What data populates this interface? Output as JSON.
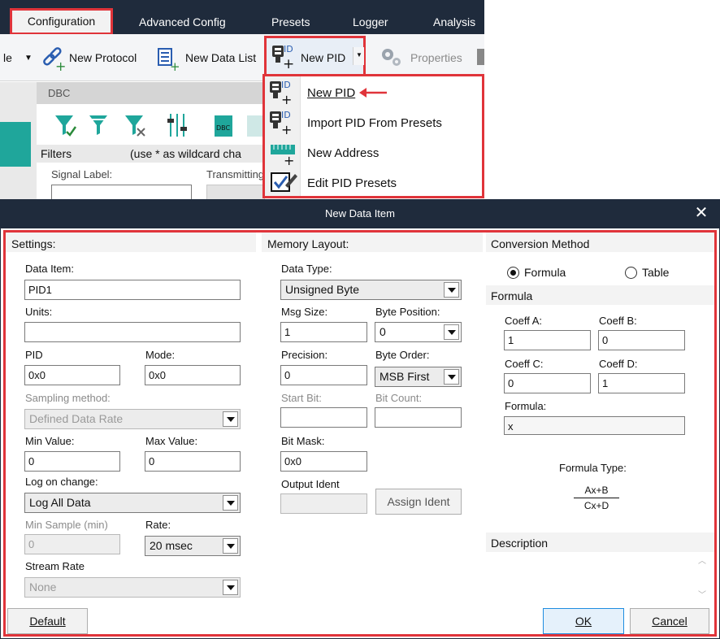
{
  "menu": {
    "configuration": "Configuration",
    "advanced": "Advanced Config",
    "presets": "Presets",
    "logger": "Logger",
    "analysis": "Analysis"
  },
  "toolbar": {
    "truncated": "le",
    "new_protocol": "New Protocol",
    "new_data_list": "New Data List",
    "new_pid": "New PID",
    "properties": "Properties"
  },
  "background": {
    "dbc": "DBC",
    "filters": "Filters",
    "filters_hint": "(use * as wildcard cha",
    "signal_label": "Signal Label:",
    "transmitting": "Transmitting"
  },
  "dropdown": {
    "items": [
      {
        "label": "New PID",
        "icon": "pid-add-icon"
      },
      {
        "label": "Import PID From Presets",
        "icon": "pid-import-icon"
      },
      {
        "label": "New Address",
        "icon": "address-add-icon"
      },
      {
        "label": "Edit PID Presets",
        "icon": "edit-check-icon"
      }
    ]
  },
  "dialog": {
    "title": "New Data Item",
    "settings": {
      "title": "Settings:",
      "data_item_label": "Data Item:",
      "data_item_value": "PID1",
      "units_label": "Units:",
      "units_value": "",
      "pid_label": "PID",
      "pid_value": "0x0",
      "mode_label": "Mode:",
      "mode_value": "0x0",
      "sampling_label": "Sampling method:",
      "sampling_value": "Defined Data Rate",
      "min_label": "Min Value:",
      "min_value": "0",
      "max_label": "Max Value:",
      "max_value": "0",
      "log_label": "Log on change:",
      "log_value": "Log All Data",
      "min_sample_label": "Min Sample (min)",
      "min_sample_value": "0",
      "rate_label": "Rate:",
      "rate_value": "20 msec",
      "stream_label": "Stream Rate",
      "stream_value": "None"
    },
    "memory": {
      "title": "Memory Layout:",
      "data_type_label": "Data Type:",
      "data_type_value": "Unsigned Byte",
      "msg_size_label": "Msg Size:",
      "msg_size_value": "1",
      "byte_pos_label": "Byte Position:",
      "byte_pos_value": "0",
      "precision_label": "Precision:",
      "precision_value": "0",
      "byte_order_label": "Byte Order:",
      "byte_order_value": "MSB First",
      "start_bit_label": "Start Bit:",
      "bit_count_label": "Bit Count:",
      "bit_mask_label": "Bit Mask:",
      "bit_mask_value": "0x0",
      "output_ident_label": "Output Ident",
      "assign_ident": "Assign Ident"
    },
    "conversion": {
      "title": "Conversion Method",
      "radio_formula": "Formula",
      "radio_table": "Table",
      "formula_title": "Formula",
      "coeff_a_label": "Coeff A:",
      "coeff_a_value": "1",
      "coeff_b_label": "Coeff B:",
      "coeff_b_value": "0",
      "coeff_c_label": "Coeff C:",
      "coeff_c_value": "0",
      "coeff_d_label": "Coeff D:",
      "coeff_d_value": "1",
      "formula_label": "Formula:",
      "formula_value": "x",
      "formula_type_label": "Formula Type:",
      "numerator": "Ax+B",
      "denominator": "Cx+D",
      "description_title": "Description"
    },
    "buttons": {
      "default": "Default",
      "ok": "OK",
      "cancel": "Cancel"
    }
  },
  "colors": {
    "titlebar": "#1f2b3c",
    "highlight": "#e0343a",
    "teal": "#1fa69b"
  }
}
